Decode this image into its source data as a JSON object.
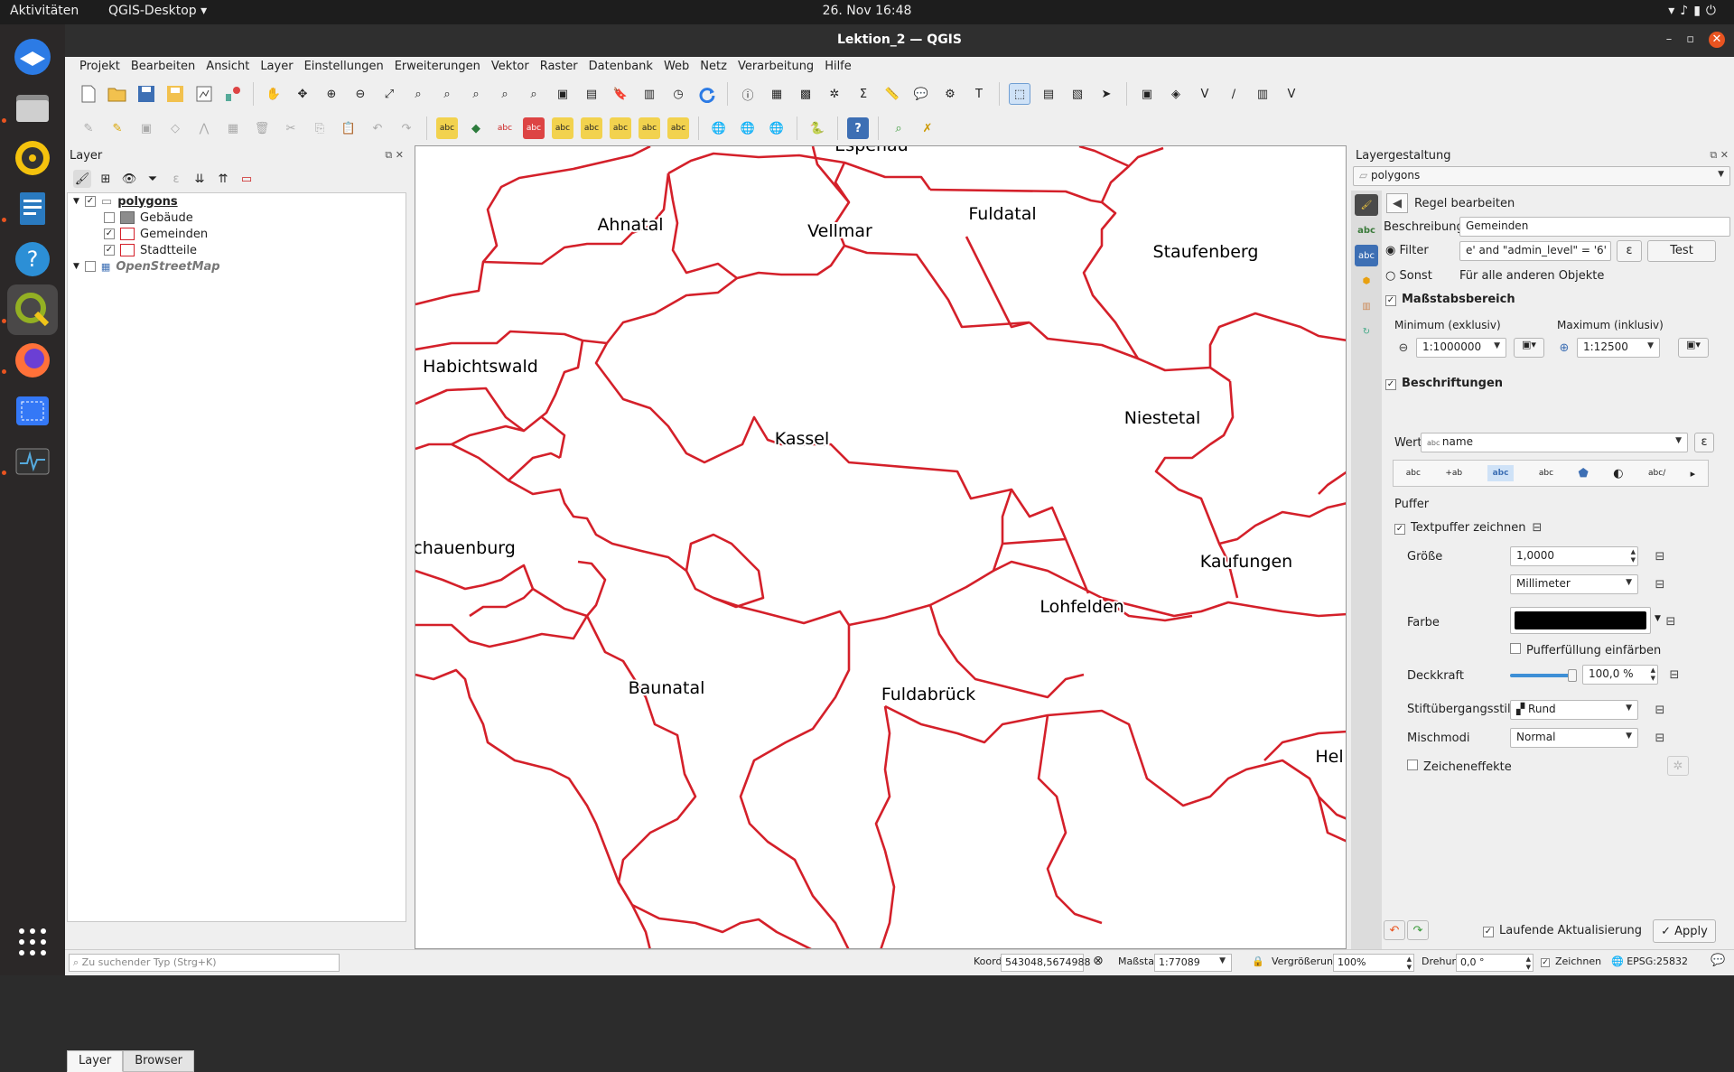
{
  "topbar": {
    "activities": "Aktivitäten",
    "app": "QGIS-Desktop ▾",
    "clock": "26. Nov  16:48"
  },
  "window": {
    "title": "Lektion_2 — QGIS"
  },
  "menu": [
    "Projekt",
    "Bearbeiten",
    "Ansicht",
    "Layer",
    "Einstellungen",
    "Erweiterungen",
    "Vektor",
    "Raster",
    "Datenbank",
    "Web",
    "Netz",
    "Verarbeitung",
    "Hilfe"
  ],
  "layers_panel": {
    "title": "Layer",
    "group": "polygons",
    "items": [
      {
        "label": "Gebäude",
        "checked": false
      },
      {
        "label": "Gemeinden",
        "checked": true
      },
      {
        "label": "Stadtteile",
        "checked": true
      }
    ],
    "osm": "OpenStreetMap",
    "tabs": [
      "Layer",
      "Browser"
    ],
    "search_placeholder": "Zu suchender Typ (Strg+K)"
  },
  "map": {
    "labels": [
      "Espenau",
      "Ahnatal",
      "Vellmar",
      "Fuldatal",
      "Staufenberg",
      "Habichtswald",
      "Kassel",
      "Niestetal",
      "Schauenburg",
      "Kaufungen",
      "Lohfelden",
      "Baunatal",
      "Fuldabrück",
      "Hel"
    ],
    "line_color": "#d4202a"
  },
  "style_panel": {
    "title": "Layergestaltung",
    "layer": "polygons",
    "rule_title": "Regel bearbeiten",
    "desc_label": "Beschreibung",
    "desc_value": "Gemeinden",
    "filter_label": "Filter",
    "filter_value": "e' and  \"admin_level\"  =  '6'",
    "test": "Test",
    "else_label": "Sonst",
    "else_text": "Für alle anderen Objekte",
    "scale_section": "Maßstabsbereich",
    "min_label": "Minimum (exklusiv)",
    "max_label": "Maximum (inklusiv)",
    "min_value": "1:1000000",
    "max_value": "1:12500",
    "labels_section": "Beschriftungen",
    "value_label": "Wert",
    "value_field": "name",
    "buffer_title": "Puffer",
    "draw_buffer": "Textpuffer zeichnen",
    "size_label": "Größe",
    "size_value": "1,0000",
    "unit_value": "Millimeter",
    "color_label": "Farbe",
    "fill_buffer": "Pufferfüllung einfärben",
    "opacity_label": "Deckkraft",
    "opacity_value": "100,0 %",
    "opacity_level": 1.0,
    "join_label": "Stiftübergangsstil",
    "join_value": "Rund",
    "blend_label": "Mischmodi",
    "blend_value": "Normal",
    "effects_label": "Zeicheneffekte",
    "live_update": "Laufende Aktualisierung",
    "apply": "Apply",
    "buffer_color": "#000000"
  },
  "statusbar": {
    "coord_label": "Koordinate",
    "coord_value": "543048,5674988",
    "scale_label": "Maßstab",
    "scale_value": "1:77089",
    "mag_label": "Vergrößerung",
    "mag_value": "100%",
    "rot_label": "Drehung",
    "rot_value": "0,0 °",
    "render_label": "Zeichnen",
    "crs": "EPSG:25832"
  }
}
